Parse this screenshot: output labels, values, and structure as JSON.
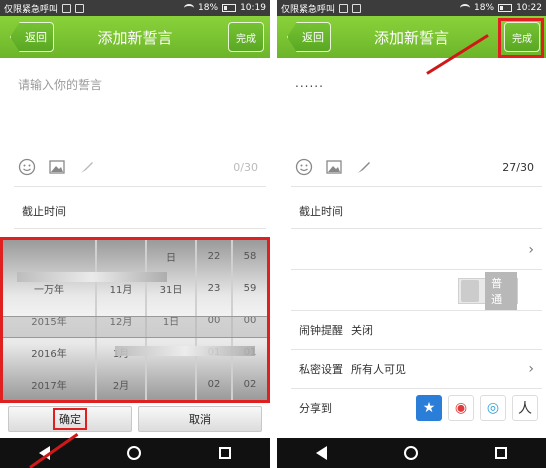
{
  "status": {
    "carrier": "仅限紧急呼叫",
    "battery": "18%",
    "time_left": "10:19",
    "time_right": "10:22"
  },
  "header": {
    "back_label": "返回",
    "title": "添加新誓言",
    "done_label": "完成"
  },
  "editor_left": {
    "placeholder": "请输入你的誓言",
    "counter": "0/30"
  },
  "editor_right": {
    "typed": "......",
    "counter": "27/30"
  },
  "rows": {
    "deadline": "截止时间",
    "alarm_label": "闹钟提醒",
    "alarm_value": "关闭",
    "privacy_label": "私密设置",
    "privacy_value": "所有人可见",
    "share_label": "分享到",
    "toggle_label": "普通"
  },
  "picker": {
    "col_year": [
      "",
      "一万年",
      "2015年",
      "2016年",
      "2017年"
    ],
    "col_month": [
      "",
      "11月",
      "12月",
      "1月",
      "2月"
    ],
    "col_day": [
      "日",
      "31日",
      "1日",
      "",
      ""
    ],
    "col_hour": [
      "22",
      "23",
      "00",
      "01",
      "02"
    ],
    "col_min": [
      "58",
      "59",
      "00",
      "01",
      "02"
    ]
  },
  "buttons": {
    "confirm": "确定",
    "cancel": "取消"
  },
  "colors": {
    "accent_green": "#6cb52a",
    "annotation_red": "#e02020"
  }
}
